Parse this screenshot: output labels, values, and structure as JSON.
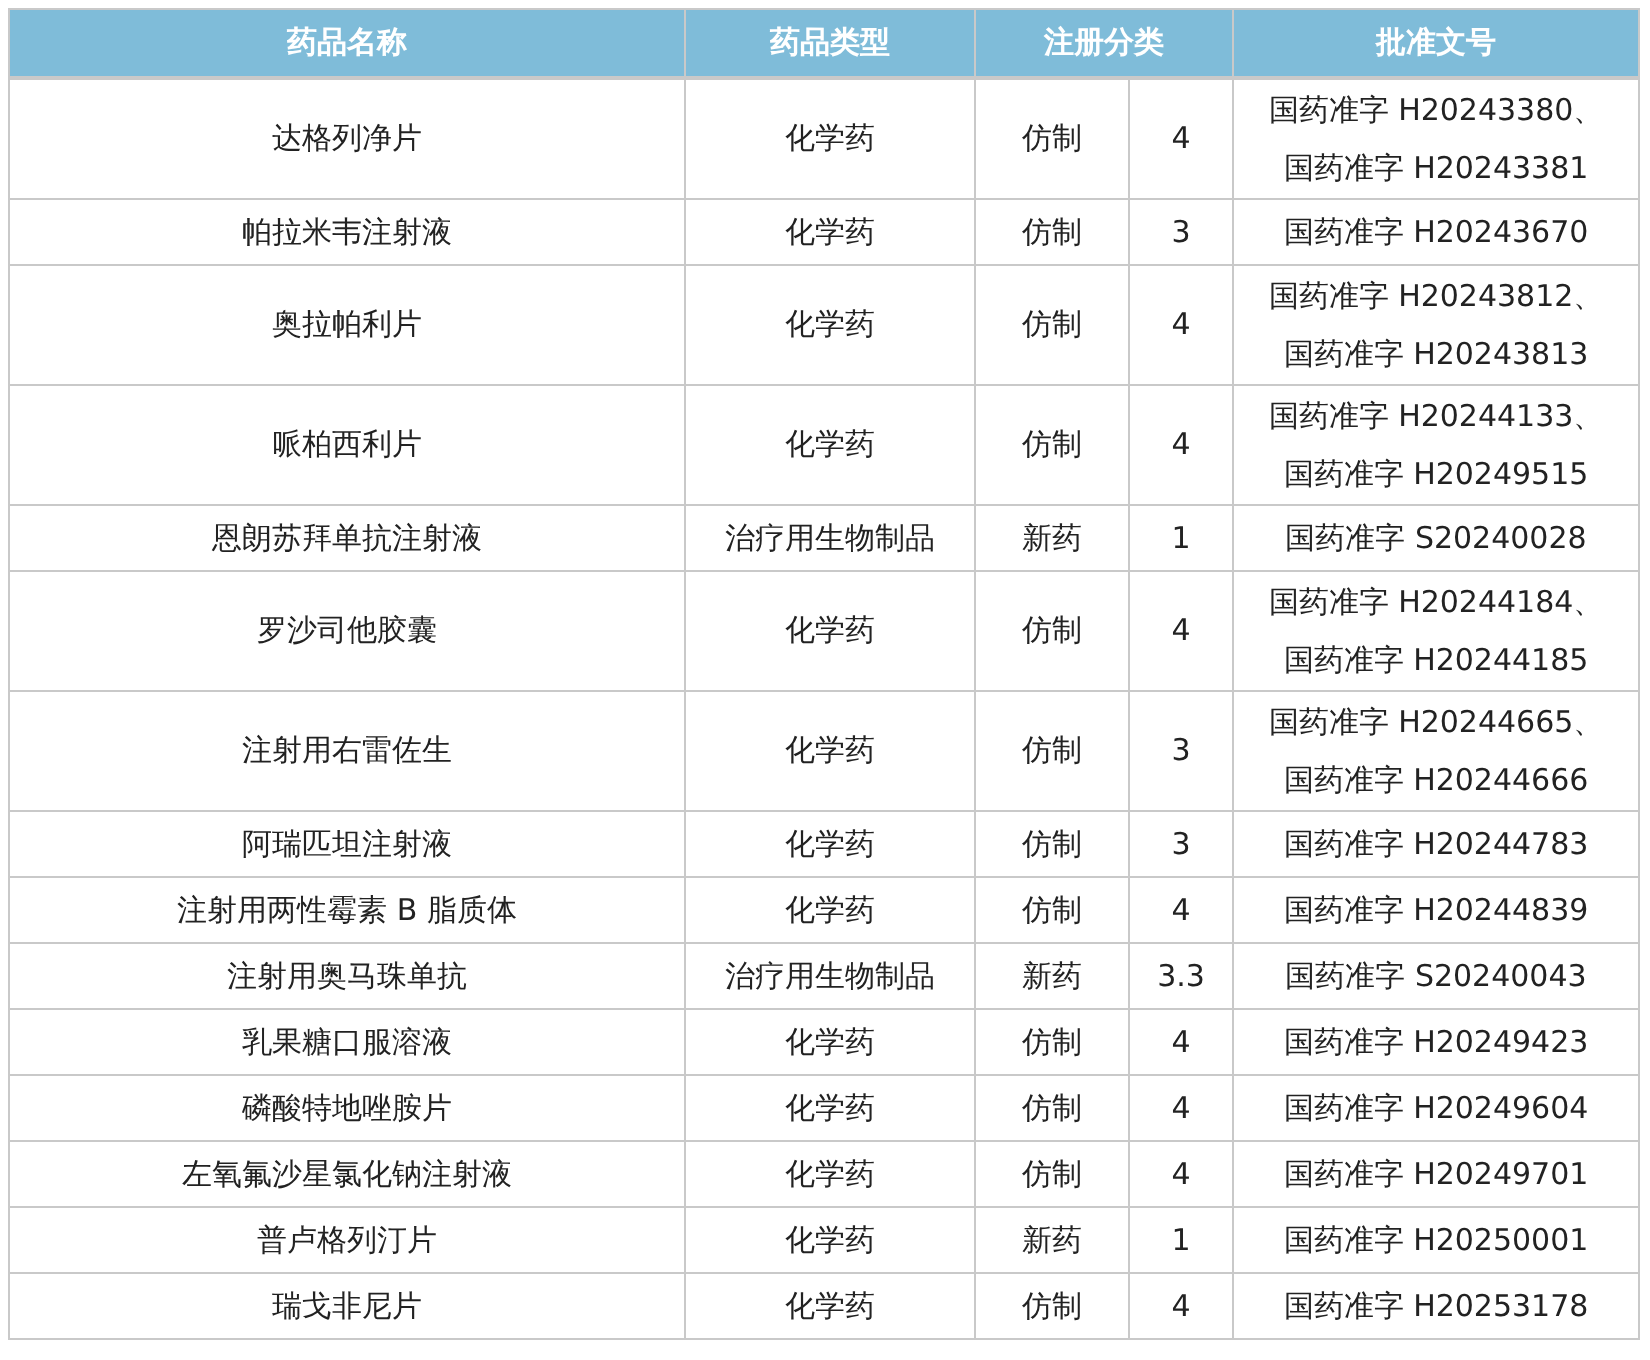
{
  "table": {
    "columns": [
      "药品名称",
      "药品类型",
      "注册分类",
      "批准文号"
    ],
    "rows": [
      {
        "name": "达格列净片",
        "type": "化学药",
        "registration": "仿制",
        "class": "4",
        "approval": [
          "国药准字 H20243380、",
          "国药准字 H20243381"
        ]
      },
      {
        "name": "帕拉米韦注射液",
        "type": "化学药",
        "registration": "仿制",
        "class": "3",
        "approval": [
          "国药准字 H20243670"
        ]
      },
      {
        "name": "奥拉帕利片",
        "type": "化学药",
        "registration": "仿制",
        "class": "4",
        "approval": [
          "国药准字 H20243812、",
          "国药准字 H20243813"
        ]
      },
      {
        "name": "哌柏西利片",
        "type": "化学药",
        "registration": "仿制",
        "class": "4",
        "approval": [
          "国药准字 H20244133、",
          "国药准字 H20249515"
        ]
      },
      {
        "name": "恩朗苏拜单抗注射液",
        "type": "治疗用生物制品",
        "registration": "新药",
        "class": "1",
        "approval": [
          "国药准字 S20240028"
        ]
      },
      {
        "name": "罗沙司他胶囊",
        "type": "化学药",
        "registration": "仿制",
        "class": "4",
        "approval": [
          "国药准字 H20244184、",
          "国药准字 H20244185"
        ]
      },
      {
        "name": "注射用右雷佐生",
        "type": "化学药",
        "registration": "仿制",
        "class": "3",
        "approval": [
          "国药准字 H20244665、",
          "国药准字 H20244666"
        ]
      },
      {
        "name": "阿瑞匹坦注射液",
        "type": "化学药",
        "registration": "仿制",
        "class": "3",
        "approval": [
          "国药准字 H20244783"
        ]
      },
      {
        "name": "注射用两性霉素 B 脂质体",
        "type": "化学药",
        "registration": "仿制",
        "class": "4",
        "approval": [
          "国药准字 H20244839"
        ]
      },
      {
        "name": "注射用奥马珠单抗",
        "type": "治疗用生物制品",
        "registration": "新药",
        "class": "3.3",
        "approval": [
          "国药准字 S20240043"
        ]
      },
      {
        "name": "乳果糖口服溶液",
        "type": "化学药",
        "registration": "仿制",
        "class": "4",
        "approval": [
          "国药准字 H20249423"
        ]
      },
      {
        "name": "磷酸特地唑胺片",
        "type": "化学药",
        "registration": "仿制",
        "class": "4",
        "approval": [
          "国药准字 H20249604"
        ]
      },
      {
        "name": "左氧氟沙星氯化钠注射液",
        "type": "化学药",
        "registration": "仿制",
        "class": "4",
        "approval": [
          "国药准字 H20249701"
        ]
      },
      {
        "name": "普卢格列汀片",
        "type": "化学药",
        "registration": "新药",
        "class": "1",
        "approval": [
          "国药准字 H20250001"
        ]
      },
      {
        "name": "瑞戈非尼片",
        "type": "化学药",
        "registration": "仿制",
        "class": "4",
        "approval": [
          "国药准字 H20253178"
        ]
      }
    ]
  }
}
